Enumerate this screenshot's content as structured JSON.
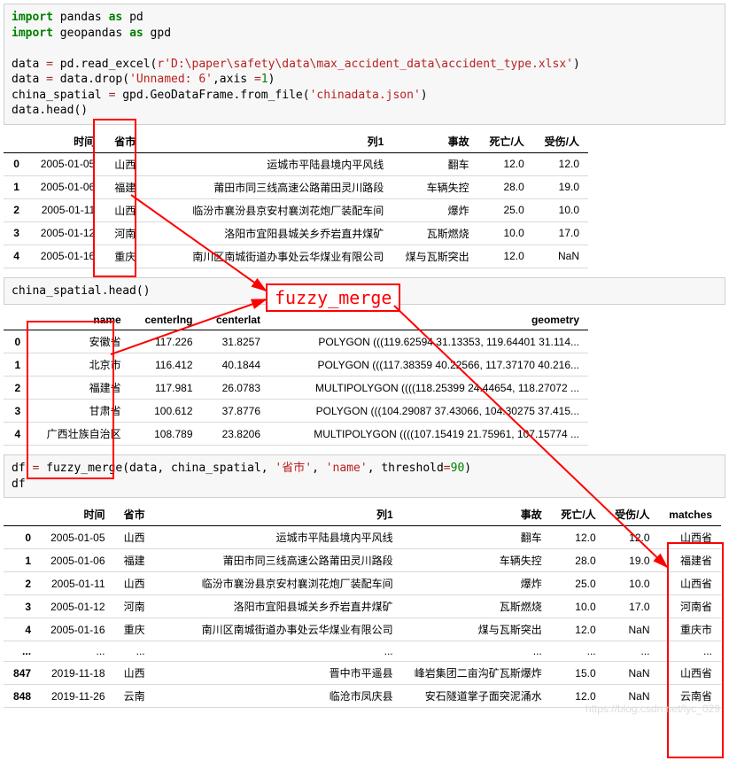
{
  "code1": {
    "l1": {
      "a": "import",
      "b": " pandas ",
      "c": "as",
      "d": " pd"
    },
    "l2": {
      "a": "import",
      "b": " geopandas ",
      "c": "as",
      "d": " gpd"
    },
    "l3": "",
    "l4": {
      "a": "data ",
      "b": "=",
      "c": " pd.read_excel(",
      "d": "r'D:\\paper\\safety\\data\\max_accident_data\\accident_type.xlsx'",
      "e": ")"
    },
    "l5": {
      "a": "data ",
      "b": "=",
      "c": " data.drop(",
      "d": "'Unnamed: 6'",
      "e": ",axis ",
      "f": "=",
      "g": "1",
      "h": ")"
    },
    "l6": {
      "a": "china_spatial ",
      "b": "=",
      "c": " gpd.GeoDataFrame.from_file(",
      "d": "'chinadata.json'",
      "e": ")"
    },
    "l7": "data.head()"
  },
  "table1": {
    "headers": [
      "",
      "时间",
      "省市",
      "列1",
      "事故",
      "死亡/人",
      "受伤/人"
    ],
    "rows": [
      [
        "0",
        "2005-01-05",
        "山西",
        "运城市平陆县境内平风线",
        "翻车",
        "12.0",
        "12.0"
      ],
      [
        "1",
        "2005-01-06",
        "福建",
        "莆田市同三线高速公路莆田灵川路段",
        "车辆失控",
        "28.0",
        "19.0"
      ],
      [
        "2",
        "2005-01-11",
        "山西",
        "临汾市襄汾县京安村襄浏花炮厂装配车间",
        "爆炸",
        "25.0",
        "10.0"
      ],
      [
        "3",
        "2005-01-12",
        "河南",
        "洛阳市宜阳县城关乡乔岩直井煤矿",
        "瓦斯燃烧",
        "10.0",
        "17.0"
      ],
      [
        "4",
        "2005-01-16",
        "重庆",
        "南川区南城街道办事处云华煤业有限公司",
        "煤与瓦斯突出",
        "12.0",
        "NaN"
      ]
    ]
  },
  "code2": "china_spatial.head()",
  "table2": {
    "headers": [
      "",
      "name",
      "centerlng",
      "centerlat",
      "geometry"
    ],
    "rows": [
      [
        "0",
        "安徽省",
        "117.226",
        "31.8257",
        "POLYGON (((119.62594 31.13353, 119.64401 31.114..."
      ],
      [
        "1",
        "北京市",
        "116.412",
        "40.1844",
        "POLYGON (((117.38359 40.22566, 117.37170 40.216..."
      ],
      [
        "2",
        "福建省",
        "117.981",
        "26.0783",
        "MULTIPOLYGON ((((118.25399 24.44654, 118.27072 ..."
      ],
      [
        "3",
        "甘肃省",
        "100.612",
        "37.8776",
        "POLYGON (((104.29087 37.43066, 104.30275 37.415..."
      ],
      [
        "4",
        "广西壮族自治区",
        "108.789",
        "23.8206",
        "MULTIPOLYGON ((((107.15419 21.75961, 107.15774 ..."
      ]
    ]
  },
  "code3": {
    "l1": {
      "a": "df ",
      "b": "=",
      "c": " fuzzy_merge(data, china_spatial, ",
      "d": "'省市'",
      "e": ", ",
      "f": "'name'",
      "g": ", threshold",
      "h": "=",
      "i": "90",
      "j": ")"
    },
    "l2": "df"
  },
  "table3": {
    "headers": [
      "",
      "时间",
      "省市",
      "列1",
      "事故",
      "死亡/人",
      "受伤/人",
      "matches"
    ],
    "rows": [
      [
        "0",
        "2005-01-05",
        "山西",
        "运城市平陆县境内平风线",
        "翻车",
        "12.0",
        "12.0",
        "山西省"
      ],
      [
        "1",
        "2005-01-06",
        "福建",
        "莆田市同三线高速公路莆田灵川路段",
        "车辆失控",
        "28.0",
        "19.0",
        "福建省"
      ],
      [
        "2",
        "2005-01-11",
        "山西",
        "临汾市襄汾县京安村襄浏花炮厂装配车间",
        "爆炸",
        "25.0",
        "10.0",
        "山西省"
      ],
      [
        "3",
        "2005-01-12",
        "河南",
        "洛阳市宜阳县城关乡乔岩直井煤矿",
        "瓦斯燃烧",
        "10.0",
        "17.0",
        "河南省"
      ],
      [
        "4",
        "2005-01-16",
        "重庆",
        "南川区南城街道办事处云华煤业有限公司",
        "煤与瓦斯突出",
        "12.0",
        "NaN",
        "重庆市"
      ],
      [
        "...",
        "...",
        "...",
        "...",
        "...",
        "...",
        "...",
        "..."
      ],
      [
        "847",
        "2019-11-18",
        "山西",
        "晋中市平遥县",
        "峰岩集团二亩沟矿瓦斯爆炸",
        "15.0",
        "NaN",
        "山西省"
      ],
      [
        "848",
        "2019-11-26",
        "云南",
        "临沧市凤庆县",
        "安石隧道掌子面突泥涌水",
        "12.0",
        "NaN",
        "云南省"
      ]
    ]
  },
  "fuzzy_label": "fuzzy_merge",
  "watermark": "https://blog.csdn.net/lyc_029"
}
